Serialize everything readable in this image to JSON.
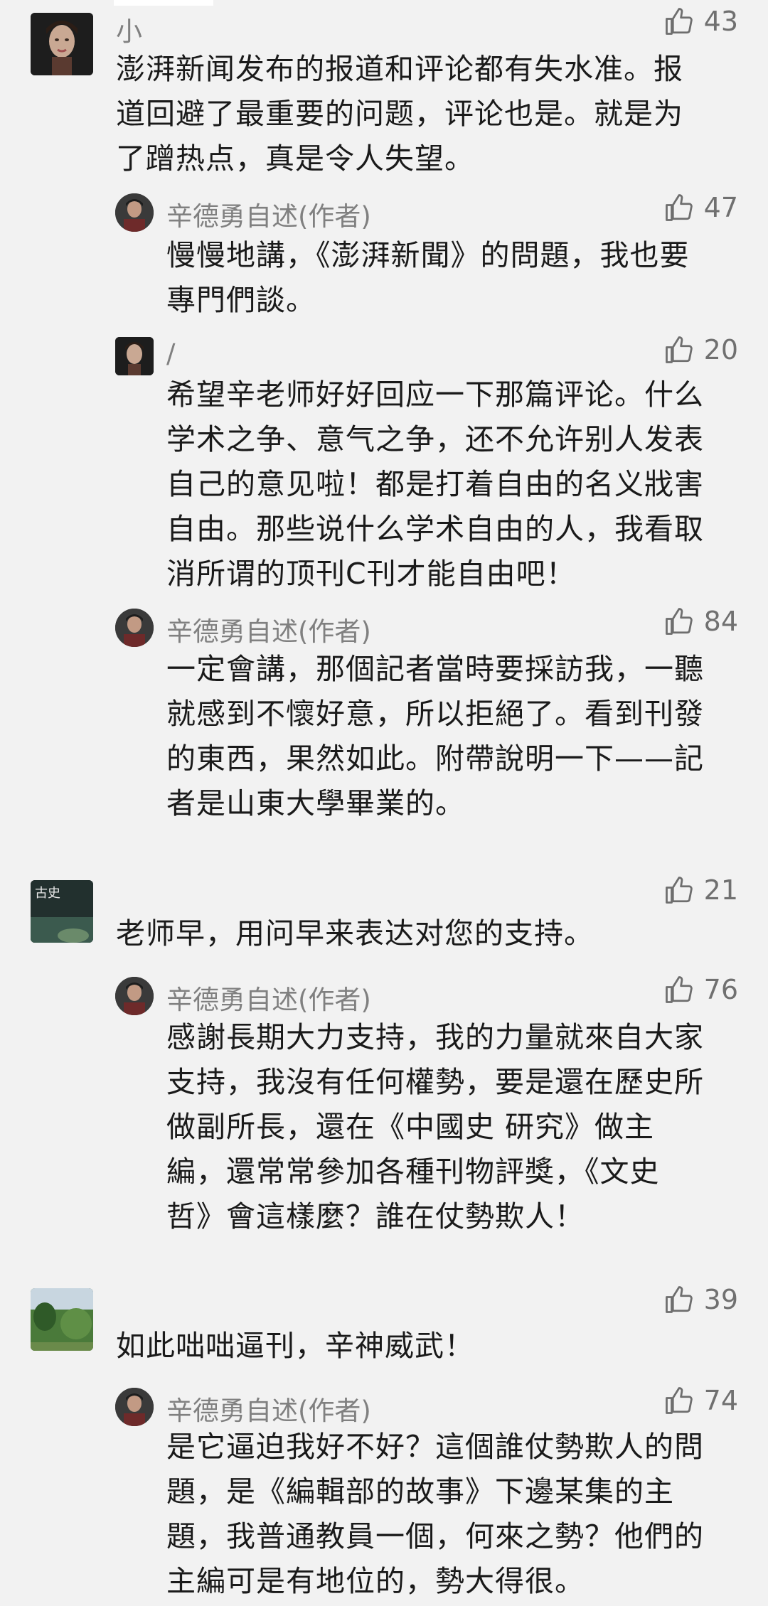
{
  "comments": [
    {
      "user": "小",
      "likes": "43",
      "text": "澎湃新闻发布的报道和评论都有失水准。报\n道回避了最重要的问题，评论也是。就是为\n了蹭热点，真是令人失望。",
      "replies": [
        {
          "user": "辛德勇自述(作者)",
          "likes": "47",
          "text": "慢慢地講，《澎湃新聞》的問題，我也要\n專門們談。"
        },
        {
          "user": "/",
          "likes": "20",
          "text": "希望辛老师好好回应一下那篇评论。什么\n学术之争、意气之争，还不允许别人发表\n自己的意见啦！都是打着自由的名义戕害\n自由。那些说什么学术自由的人，我看取\n消所谓的顶刊C刊才能自由吧！"
        },
        {
          "user": "辛德勇自述(作者)",
          "likes": "84",
          "text": "一定會講，那個記者當時要採訪我，一聽\n就感到不懷好意，所以拒絕了。看到刊發\n的東西，果然如此。附帶說明一下——記\n者是山東大學畢業的。"
        }
      ]
    },
    {
      "user": "",
      "avatar_text": "古史",
      "likes": "21",
      "text": "老师早，用问早来表达对您的支持。",
      "replies": [
        {
          "user": "辛德勇自述(作者)",
          "likes": "76",
          "text": "感謝長期大力支持，我的力量就來自大家\n支持，我沒有任何權勢，要是還在歷史所\n做副所長，還在《中國史 研究》做主\n編，還常常參加各種刊物評獎，《文史\n哲》會這樣麼？誰在仗勢欺人！"
        }
      ]
    },
    {
      "user": "",
      "likes": "39",
      "text": "如此咄咄逼刊，辛神威武！",
      "replies": [
        {
          "user": "辛德勇自述(作者)",
          "likes": "74",
          "text": "是它逼迫我好不好？這個誰仗勢欺人的問\n題，是《編輯部的故事》下邊某集的主\n題，我普通教員一個，何來之勢？他們的\n主編可是有地位的，勢大得很。"
        }
      ]
    }
  ]
}
